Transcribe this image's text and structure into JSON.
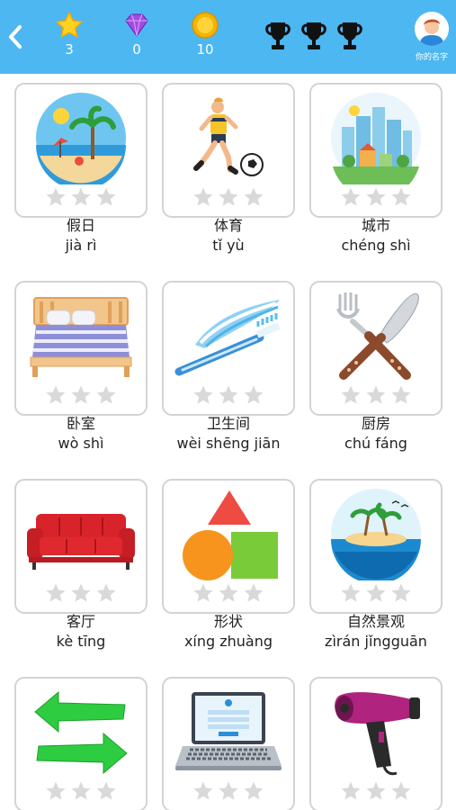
{
  "header": {
    "back": "back",
    "stars": "3",
    "gems": "0",
    "coins": "10",
    "trophy_count": 3,
    "profile_name": "你的名字"
  },
  "colors": {
    "header_bg": "#4DB7F1",
    "card_border": "#D3D3D3",
    "rating_star": "#D9D9D9"
  },
  "topics": [
    {
      "zh": "假日",
      "py": "jià rì",
      "icon": "beach-icon",
      "rating": 0
    },
    {
      "zh": "体育",
      "py": "tǐ yù",
      "icon": "soccer-player-icon",
      "rating": 0
    },
    {
      "zh": "城市",
      "py": "chéng shì",
      "icon": "city-icon",
      "rating": 0
    },
    {
      "zh": "卧室",
      "py": "wò shì",
      "icon": "bed-icon",
      "rating": 0
    },
    {
      "zh": "卫生间",
      "py": "wèi shēng jiān",
      "icon": "toothbrush-icon",
      "rating": 0
    },
    {
      "zh": "厨房",
      "py": "chú fáng",
      "icon": "fork-knife-icon",
      "rating": 0
    },
    {
      "zh": "客厅",
      "py": "kè tīng",
      "icon": "sofa-icon",
      "rating": 0
    },
    {
      "zh": "形状",
      "py": "xíng zhuàng",
      "icon": "shapes-icon",
      "rating": 0
    },
    {
      "zh": "自然景观",
      "py": "zìrán jǐngguān",
      "icon": "island-icon",
      "rating": 0
    },
    {
      "zh": "",
      "py": "",
      "icon": "arrows-icon",
      "rating": 0
    },
    {
      "zh": "",
      "py": "",
      "icon": "laptop-icon",
      "rating": 0
    },
    {
      "zh": "",
      "py": "",
      "icon": "hair-dryer-icon",
      "rating": 0
    }
  ]
}
